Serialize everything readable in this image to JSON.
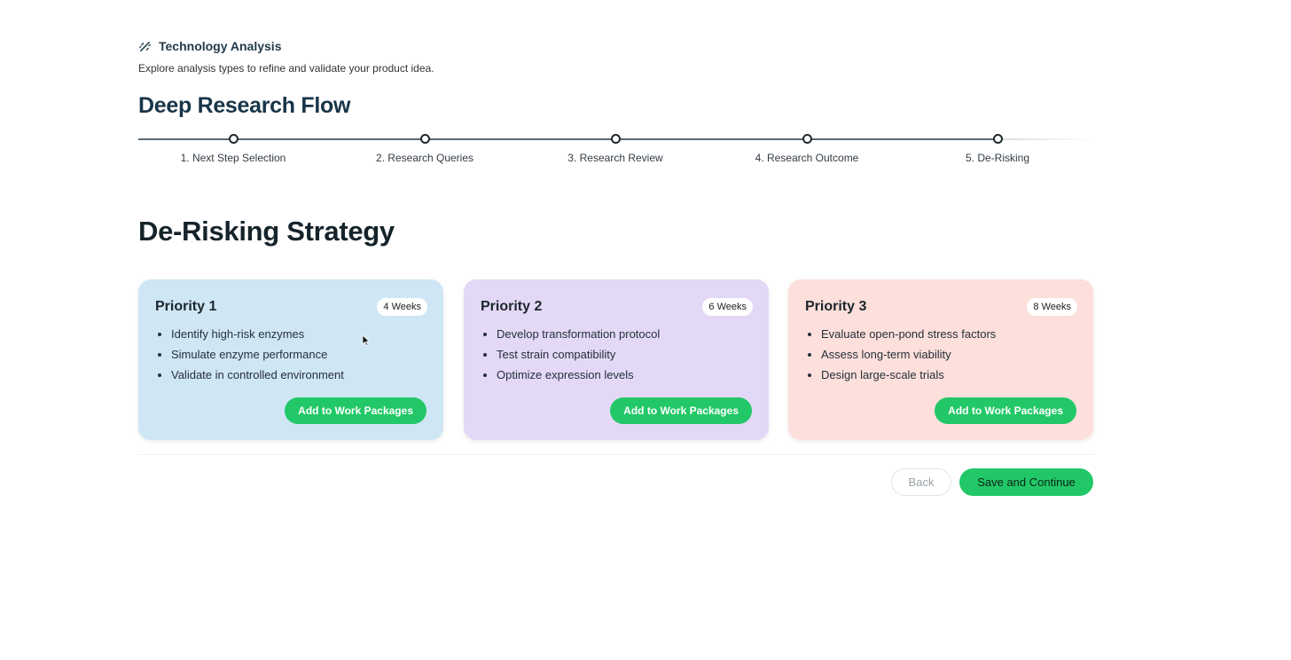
{
  "header": {
    "icon": "sparkle-icon",
    "title": "Technology Analysis",
    "subtitle": "Explore analysis types to refine and validate your product idea."
  },
  "flow": {
    "title": "Deep Research Flow",
    "steps": [
      {
        "label": "1. Next Step Selection"
      },
      {
        "label": "2. Research Queries"
      },
      {
        "label": "3. Research Review"
      },
      {
        "label": "4. Research Outcome"
      },
      {
        "label": "5. De-Risking"
      }
    ]
  },
  "strategy": {
    "title": "De-Risking Strategy",
    "cards": [
      {
        "title": "Priority 1",
        "duration": "4 Weeks",
        "color": "#cfe6f5",
        "items": [
          "Identify high-risk enzymes",
          "Simulate enzyme performance",
          "Validate in controlled environment"
        ],
        "button": "Add to Work Packages"
      },
      {
        "title": "Priority 2",
        "duration": "6 Weeks",
        "color": "#e3d9f6",
        "items": [
          "Develop transformation protocol",
          "Test strain compatibility",
          "Optimize expression levels"
        ],
        "button": "Add to Work Packages"
      },
      {
        "title": "Priority 3",
        "duration": "8 Weeks",
        "color": "#fddfdb",
        "items": [
          "Evaluate open-pond stress factors",
          "Assess long-term viability",
          "Design large-scale trials"
        ],
        "button": "Add to Work Packages"
      }
    ]
  },
  "actions": {
    "back": "Back",
    "continue": "Save and Continue"
  },
  "colors": {
    "accent": "#22c867",
    "title": "#183548"
  }
}
